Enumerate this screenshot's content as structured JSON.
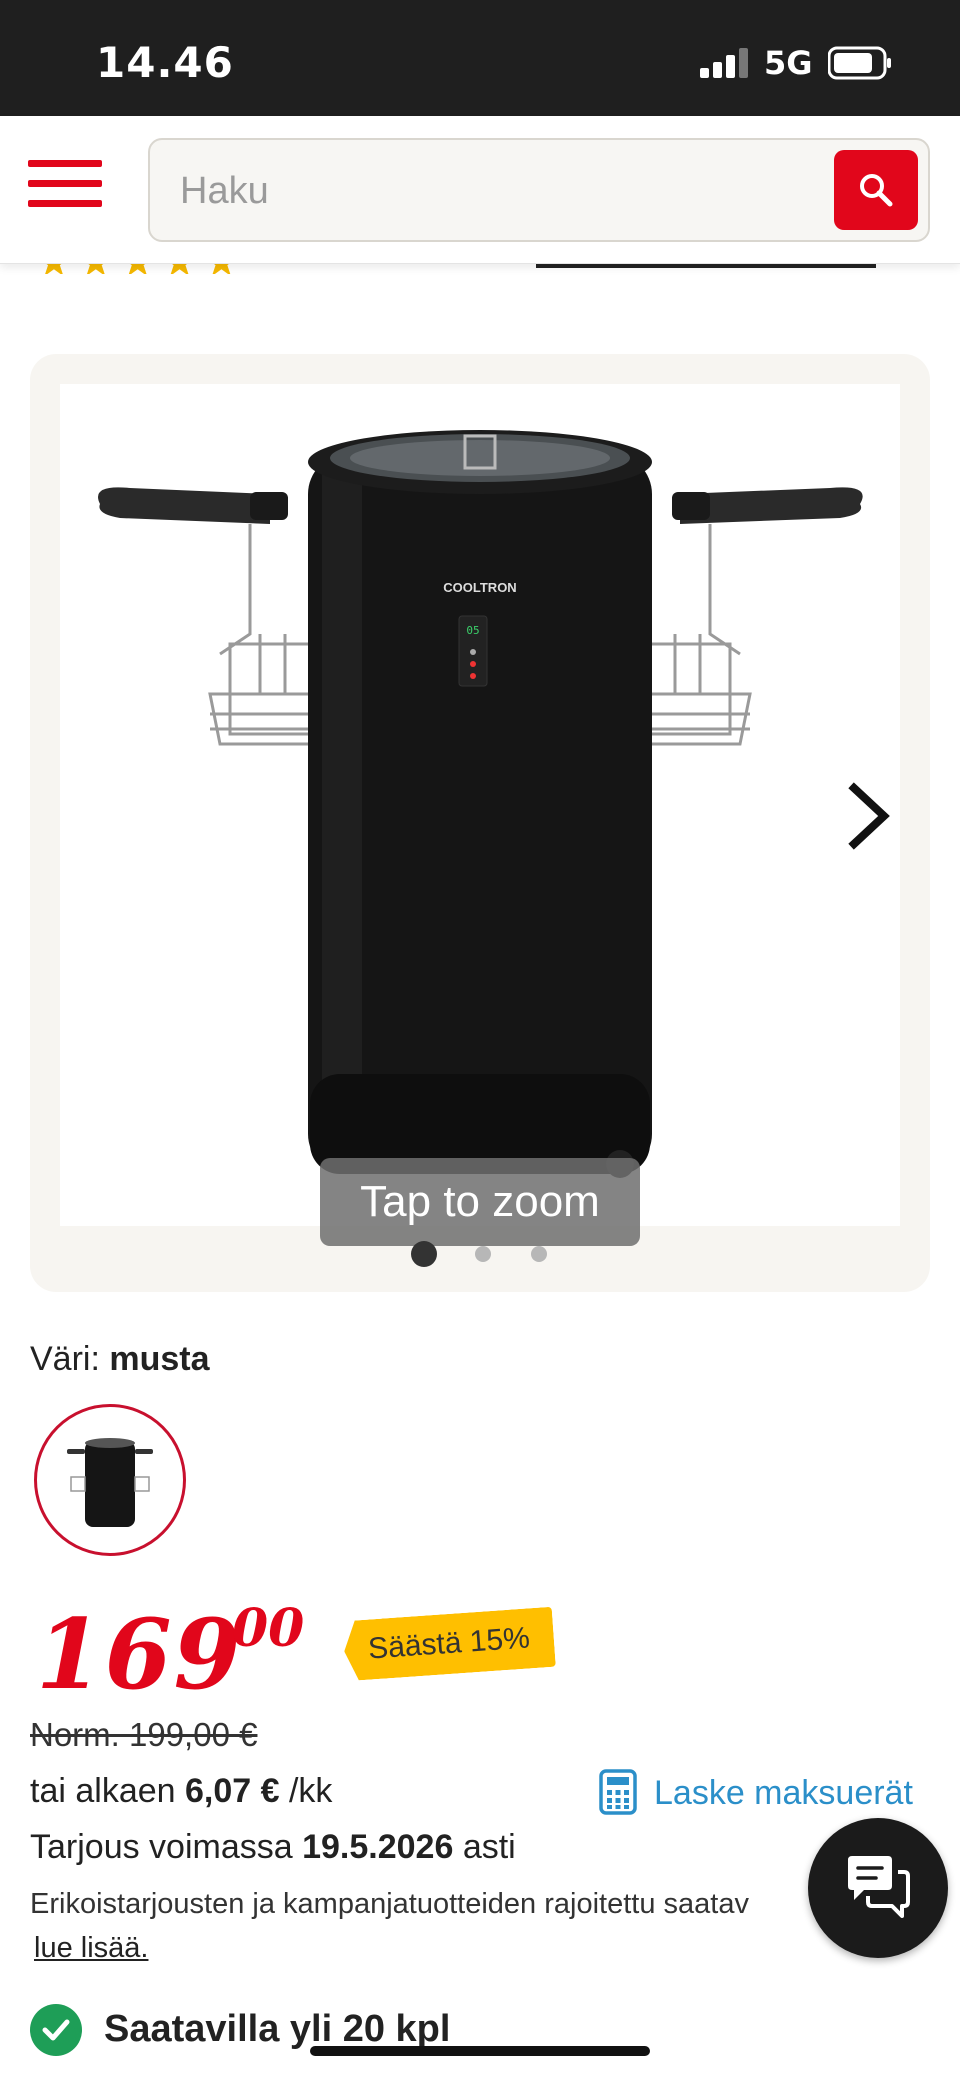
{
  "status_bar": {
    "time": "14.46",
    "network": "5G"
  },
  "header": {
    "search_placeholder": "Haku"
  },
  "gallery": {
    "zoom_label": "Tap to zoom",
    "slide_count": 3,
    "active_slide": 1,
    "product_brand_text": "COOLTRON",
    "display_readout": "05"
  },
  "color": {
    "label": "Väri:",
    "value": "musta"
  },
  "price": {
    "integer": "169",
    "decimals": "00",
    "save_badge": "Säästä 15%",
    "normal": "Norm. 199,00 €"
  },
  "installment": {
    "prefix": "tai alkaen",
    "amount": "6,07 €",
    "suffix": "/kk",
    "calc_link": "Laske maksuerät"
  },
  "offer": {
    "prefix": "Tarjous voimassa",
    "date": "19.5.2026",
    "suffix": "asti"
  },
  "disclaimer": {
    "text": "Erikoistarjousten ja kampanjatuotteiden rajoitettu saatav",
    "read_more": "lue lisää."
  },
  "availability": {
    "text": "Saatavilla yli 20 kpl"
  },
  "colors": {
    "brand_red": "#e1061b",
    "link_blue": "#2b8fc9",
    "badge_yellow": "#ffbf00",
    "stock_green": "#1e9e57"
  }
}
